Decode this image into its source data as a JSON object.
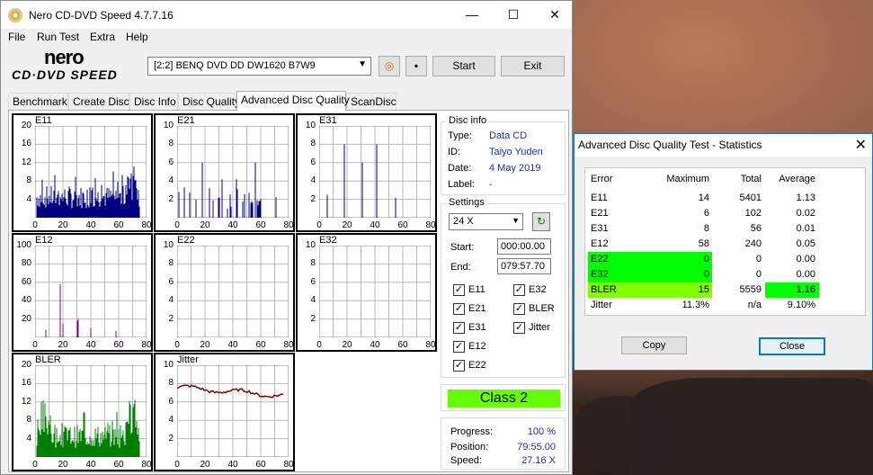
{
  "app": {
    "title": "Nero CD-DVD Speed 4.7.7.16",
    "logo_top": "nero",
    "logo_bottom": "CD·DVD SPEED"
  },
  "window_controls": {
    "minimize": "—",
    "maximize": "☐",
    "close": "✕"
  },
  "menu": [
    "File",
    "Run Test",
    "Extra",
    "Help"
  ],
  "toolbar": {
    "drive": "[2:2]   BENQ DVD DD DW1620 B7W9",
    "start_label": "Start",
    "exit_label": "Exit"
  },
  "tabs": [
    "Benchmark",
    "Create Disc",
    "Disc Info",
    "Disc Quality",
    "Advanced Disc Quality",
    "ScanDisc"
  ],
  "active_tab": "Advanced Disc Quality",
  "graphs": [
    {
      "label": "E11",
      "yticks": [
        "20",
        "16",
        "12",
        "8",
        "4"
      ],
      "color": "#000080"
    },
    {
      "label": "E21",
      "yticks": [
        "10",
        "8",
        "6",
        "4",
        "2"
      ],
      "color": "#000080"
    },
    {
      "label": "E31",
      "yticks": [
        "10",
        "8",
        "6",
        "4",
        "2"
      ],
      "color": "#000080"
    },
    {
      "label": "E12",
      "yticks": [
        "100",
        "80",
        "60",
        "40",
        "20"
      ],
      "color": "#800080"
    },
    {
      "label": "E22",
      "yticks": [
        "10",
        "8",
        "6",
        "4",
        "2"
      ],
      "color": "#000080"
    },
    {
      "label": "E32",
      "yticks": [
        "10",
        "8",
        "6",
        "4",
        "2"
      ],
      "color": "#000080"
    },
    {
      "label": "BLER",
      "yticks": [
        "20",
        "16",
        "12",
        "8",
        "4"
      ],
      "color": "#008000"
    },
    {
      "label": "Jitter",
      "yticks": [
        "10",
        "8",
        "6",
        "4",
        "2"
      ],
      "color": "#800000"
    }
  ],
  "xticks": [
    "0",
    "20",
    "40",
    "60",
    "80"
  ],
  "disc_info": {
    "title": "Disc info",
    "type_label": "Type:",
    "type": "Data CD",
    "id_label": "ID:",
    "id": "Taiyo Yuden",
    "date_label": "Date:",
    "date": "4 May 2019",
    "label_label": "Label:",
    "label": "-"
  },
  "settings": {
    "title": "Settings",
    "speed": "24 X",
    "start_label": "Start:",
    "start": "000:00.00",
    "end_label": "End:",
    "end": "079:57.70",
    "checks": [
      "E11",
      "E32",
      "E21",
      "BLER",
      "E31",
      "Jitter",
      "E12",
      "E22"
    ]
  },
  "class_badge": {
    "text": "Class 2",
    "color": "#66ff00"
  },
  "progress": {
    "progress_label": "Progress:",
    "progress": "100 %",
    "position_label": "Position:",
    "position": "79:55.00",
    "speed_label": "Speed:",
    "speed": "27.16 X"
  },
  "stats_dialog": {
    "title": "Advanced Disc Quality Test - Statistics",
    "columns": [
      "Error",
      "Maximum",
      "Total",
      "Average"
    ],
    "rows": [
      {
        "name": "E11",
        "max": "14",
        "total": "5401",
        "avg": "1.13"
      },
      {
        "name": "E21",
        "max": "6",
        "total": "102",
        "avg": "0.02"
      },
      {
        "name": "E31",
        "max": "8",
        "total": "56",
        "avg": "0.01"
      },
      {
        "name": "E12",
        "max": "58",
        "total": "240",
        "avg": "0.05"
      },
      {
        "name": "E22",
        "max": "0",
        "total": "0",
        "avg": "0.00"
      },
      {
        "name": "E32",
        "max": "0",
        "total": "0",
        "avg": "0.00"
      },
      {
        "name": "BLER",
        "max": "15",
        "total": "5559",
        "avg": "1.16"
      },
      {
        "name": "Jitter",
        "max": "11.3%",
        "total": "n/a",
        "avg": "9.10%"
      }
    ],
    "highlight_color": "#00ff00",
    "bler_color": "#80ff00",
    "copy_label": "Copy",
    "close_label": "Close"
  }
}
